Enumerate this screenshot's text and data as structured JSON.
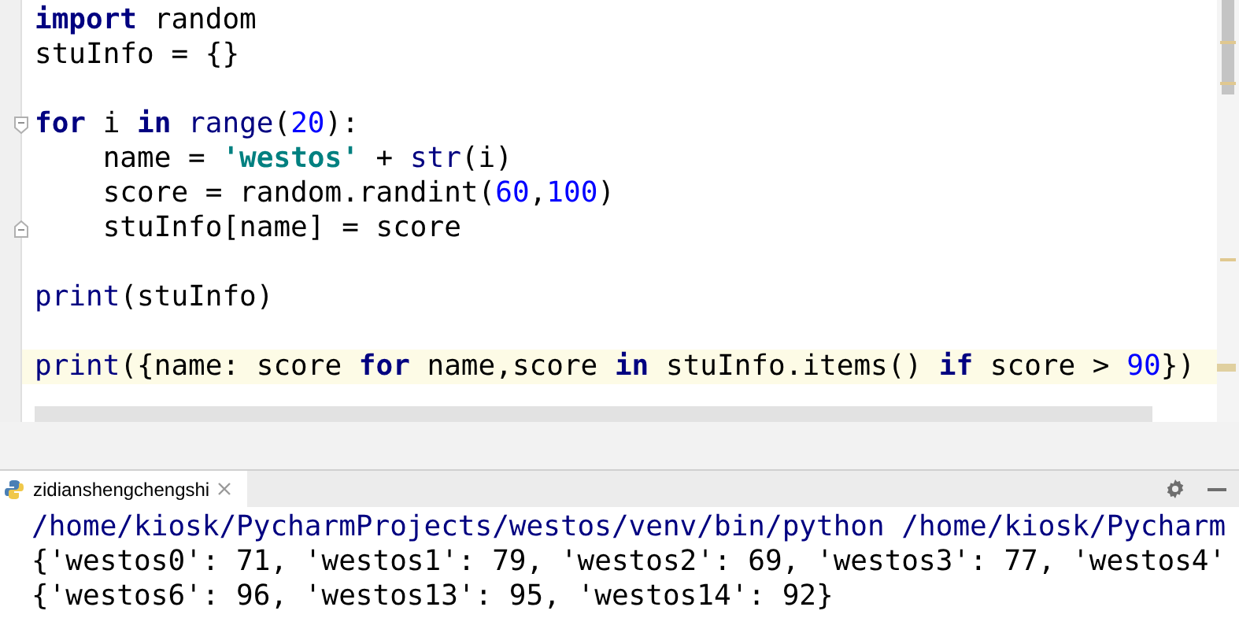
{
  "editor": {
    "lines": [
      {
        "kind": "code",
        "tokens": [
          {
            "text": "import",
            "kind": "keyword"
          },
          {
            "text": " random",
            "kind": "plain"
          }
        ]
      },
      {
        "kind": "code",
        "tokens": [
          {
            "text": "stuInfo = {}",
            "kind": "plain"
          }
        ]
      },
      {
        "kind": "blank"
      },
      {
        "kind": "code",
        "fold_start": true,
        "tokens": [
          {
            "text": "for",
            "kind": "keyword"
          },
          {
            "text": " i ",
            "kind": "plain"
          },
          {
            "text": "in",
            "kind": "keyword"
          },
          {
            "text": " range",
            "kind": "builtin"
          },
          {
            "text": "(",
            "kind": "plain"
          },
          {
            "text": "20",
            "kind": "number"
          },
          {
            "text": "):",
            "kind": "plain"
          }
        ]
      },
      {
        "kind": "code",
        "tokens": [
          {
            "text": "    name = ",
            "kind": "plain"
          },
          {
            "text": "'westos'",
            "kind": "string"
          },
          {
            "text": " + ",
            "kind": "plain"
          },
          {
            "text": "str",
            "kind": "builtin"
          },
          {
            "text": "(i)",
            "kind": "plain"
          }
        ]
      },
      {
        "kind": "code",
        "tokens": [
          {
            "text": "    score = random.randint(",
            "kind": "plain"
          },
          {
            "text": "60",
            "kind": "number"
          },
          {
            "text": ",",
            "kind": "plain"
          },
          {
            "text": "100",
            "kind": "number"
          },
          {
            "text": ")",
            "kind": "plain"
          }
        ]
      },
      {
        "kind": "code",
        "fold_end": true,
        "tokens": [
          {
            "text": "    stuInfo[name] = score",
            "kind": "plain"
          }
        ]
      },
      {
        "kind": "blank"
      },
      {
        "kind": "code",
        "tokens": [
          {
            "text": "print",
            "kind": "builtin"
          },
          {
            "text": "(stuInfo)",
            "kind": "plain"
          }
        ]
      },
      {
        "kind": "blank"
      },
      {
        "kind": "code",
        "current": true,
        "tokens": [
          {
            "text": "print",
            "kind": "builtin"
          },
          {
            "text": "({name: score ",
            "kind": "plain"
          },
          {
            "text": "for",
            "kind": "keyword"
          },
          {
            "text": " name,score ",
            "kind": "plain"
          },
          {
            "text": "in",
            "kind": "keyword"
          },
          {
            "text": " stuInfo.items() ",
            "kind": "plain"
          },
          {
            "text": "if",
            "kind": "keyword"
          },
          {
            "text": " score > ",
            "kind": "plain"
          },
          {
            "text": "90",
            "kind": "number"
          },
          {
            "text": "})",
            "kind": "plain"
          }
        ]
      }
    ]
  },
  "run_panel": {
    "tab": {
      "label": "zidianshengchengshi",
      "selected": true
    },
    "output": [
      {
        "kind": "command",
        "text": "/home/kiosk/PycharmProjects/westos/venv/bin/python /home/kiosk/Pycharm"
      },
      {
        "kind": "stdout",
        "text": "{'westos0': 71, 'westos1': 79, 'westos2': 69, 'westos3': 77, 'westos4'"
      },
      {
        "kind": "stdout",
        "text": "{'westos6': 96, 'westos13': 95, 'westos14': 92}"
      }
    ]
  }
}
